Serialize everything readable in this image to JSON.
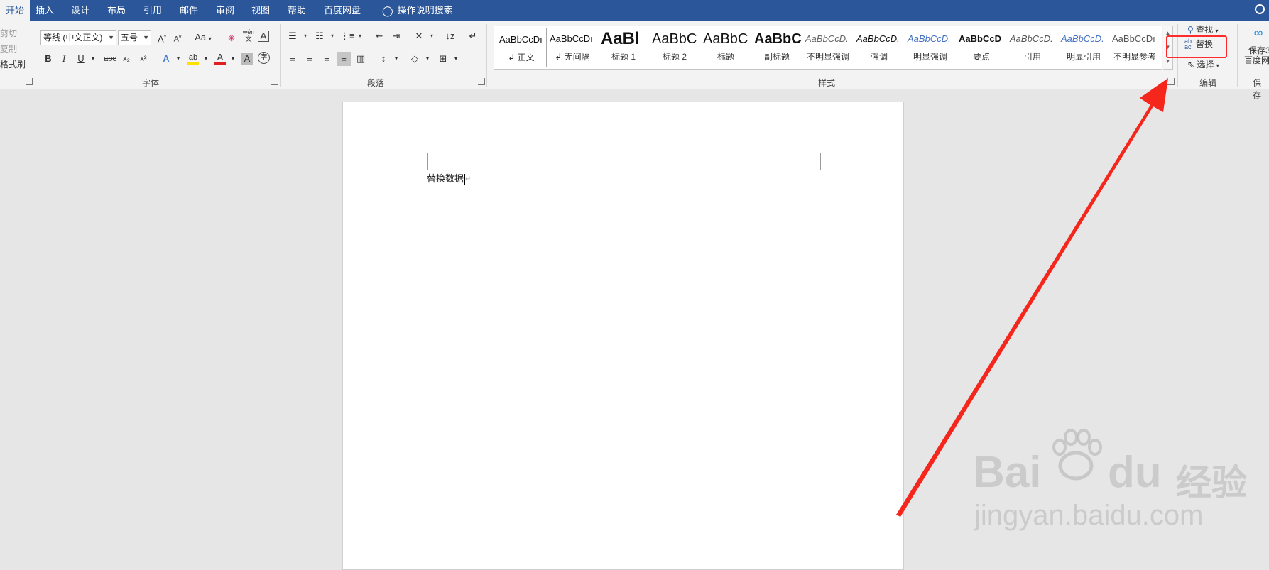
{
  "tabs": [
    {
      "label": "开始",
      "active": true
    },
    {
      "label": "插入"
    },
    {
      "label": "设计"
    },
    {
      "label": "布局"
    },
    {
      "label": "引用"
    },
    {
      "label": "邮件"
    },
    {
      "label": "审阅"
    },
    {
      "label": "视图"
    },
    {
      "label": "帮助"
    },
    {
      "label": "百度网盘"
    }
  ],
  "tell_me": "操作说明搜索",
  "clipboard": {
    "cut": "剪切",
    "copy": "复制",
    "format_painter": "格式刷"
  },
  "font": {
    "name": "等线 (中文正文)",
    "size": "五号",
    "group_label": "字体",
    "grow": "A",
    "shrink": "A",
    "case": "Aa",
    "phonetic": "wén",
    "bold": "B",
    "italic": "I",
    "underline": "U",
    "strike": "abc",
    "subscript": "x₂",
    "superscript": "x²",
    "font_color": "A",
    "char_shade": "A",
    "enclose": "字"
  },
  "paragraph": {
    "group_label": "段落"
  },
  "styles": {
    "group_label": "样式",
    "items": [
      {
        "sample": "AaBbCcDı",
        "name": "↲ 正文"
      },
      {
        "sample": "AaBbCcDı",
        "name": "↲ 无间隔"
      },
      {
        "sample": "AaBl",
        "name": "标题 1"
      },
      {
        "sample": "AaBbC",
        "name": "标题 2"
      },
      {
        "sample": "AaBbC",
        "name": "标题"
      },
      {
        "sample": "AaBbC",
        "name": "副标题"
      },
      {
        "sample": "AaBbCcD.",
        "name": "不明显强调"
      },
      {
        "sample": "AaBbCcD.",
        "name": "强调"
      },
      {
        "sample": "AaBbCcD.",
        "name": "明显强调"
      },
      {
        "sample": "AaBbCcD",
        "name": "要点"
      },
      {
        "sample": "AaBbCcD.",
        "name": "引用"
      },
      {
        "sample": "AaBbCcD.",
        "name": "明显引用"
      },
      {
        "sample": "AaBbCcDı",
        "name": "不明显参考"
      }
    ]
  },
  "editing": {
    "group_label": "编辑",
    "find": "查找",
    "replace": "替换",
    "select": "选择",
    "replace_icon_top": "ab",
    "replace_icon_bottom": "ac"
  },
  "save": {
    "group_label": "保存",
    "line1": "保存3",
    "line2": "百度网"
  },
  "document": {
    "text": "替换数据"
  },
  "watermark": {
    "brand": "Bai",
    "brand2": "du",
    "cn": "经验",
    "url": "jingyan.baidu.com"
  },
  "colors": {
    "tab_blue": "#2b579a",
    "highlight_red": "#ff2a2a",
    "arrow_red": "#f5271c"
  }
}
